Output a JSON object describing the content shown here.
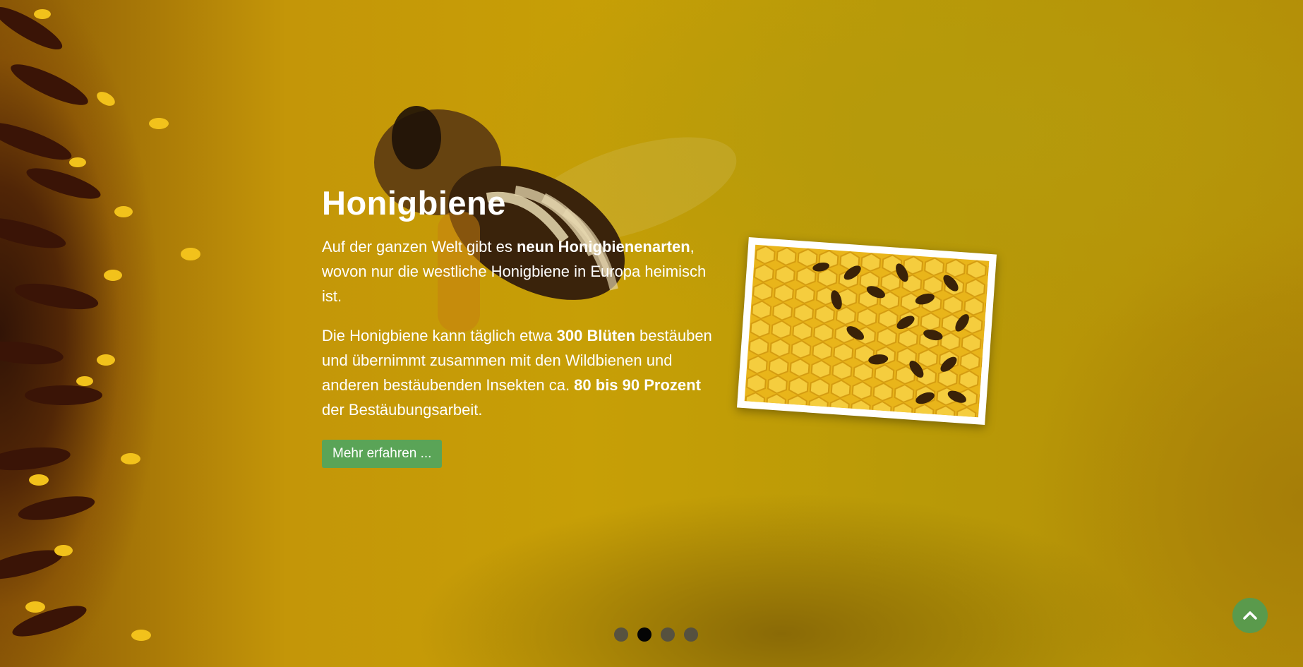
{
  "slide": {
    "title": "Honigbiene",
    "paragraph1": {
      "pre": "Auf der ganzen Welt gibt es ",
      "bold": "neun Honigbienenarten",
      "post": ", wovon nur die westliche Honigbiene in Europa heimisch ist."
    },
    "paragraph2": {
      "pre": "Die Honigbiene kann täglich etwa ",
      "bold1": "300 Blüten",
      "mid": " bestäuben und übernimmt zusammen mit den Wildbienen und anderen bestäubenden Insekten ca. ",
      "bold2": "80 bis 90 Prozent",
      "post": " der Bestäubungsarbeit."
    },
    "button_label": "Mehr erfahren ..."
  },
  "carousel": {
    "slide_count": 4,
    "active_index": 1
  },
  "icons": {
    "scroll_top": "chevron-up-icon",
    "photo": "honeycomb-bees-photo"
  },
  "colors": {
    "button": "#5aa457",
    "scroll_top": "#5a9a4c",
    "dot_active": "#050505",
    "dot_inactive": "#4a4a4a"
  }
}
